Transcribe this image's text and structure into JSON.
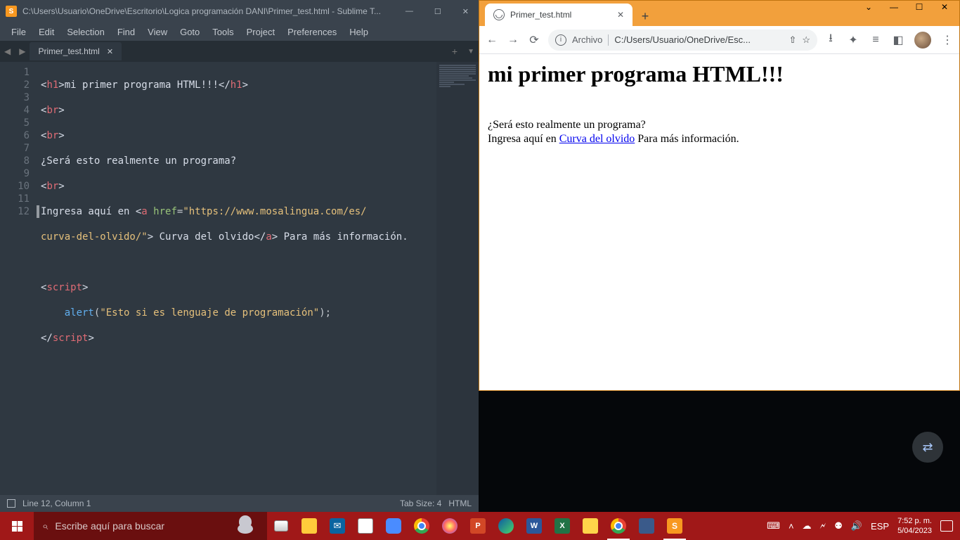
{
  "sublime": {
    "title": "C:\\Users\\Usuario\\OneDrive\\Escritorio\\Logica programación DANI\\Primer_test.html - Sublime T...",
    "menu": [
      "File",
      "Edit",
      "Selection",
      "Find",
      "View",
      "Goto",
      "Tools",
      "Project",
      "Preferences",
      "Help"
    ],
    "tab_label": "Primer_test.html",
    "lines": [
      "1",
      "2",
      "3",
      "4",
      "5",
      "6",
      "7",
      "8",
      "9",
      "10",
      "11",
      "12"
    ],
    "code": {
      "l1_open": "<h1>",
      "l1_txt": "mi primer programa HTML!!!",
      "l1_close": "</h1>",
      "l2": "<br>",
      "l3": "<br>",
      "l4": "¿Será esto realmente un programa?",
      "l5": "<br>",
      "l6a": "Ingresa aquí en ",
      "l6_tag": "<a ",
      "l6_attr": "href",
      "l6_eq": "=",
      "l6_url": "\"https://www.mosalingua.com/es/",
      "l6b_url": "curva-del-olvido/\"",
      "l6b_close": ">",
      "l6b_txt": " Curva del olvido",
      "l6b_cl": "</a>",
      "l6b_tail": " Para más información.",
      "l8_open": "<script>",
      "l9_indent": "    ",
      "l9_fn": "alert",
      "l9_p1": "(",
      "l9_str": "\"Esto si es lenguaje de programación\"",
      "l9_p2": ");",
      "l10_close": "</script>"
    },
    "status": {
      "pos": "Line 12, Column 1",
      "tabsize": "Tab Size: 4",
      "lang": "HTML"
    }
  },
  "chrome": {
    "tab_title": "Primer_test.html",
    "omnibox": {
      "scheme": "Archivo",
      "path": "C:/Users/Usuario/OneDrive/Esc..."
    },
    "page": {
      "h1": "mi primer programa HTML!!!",
      "q": "¿Será esto realmente un programa?",
      "pre": "Ingresa aquí en ",
      "link": "Curva del olvido",
      "post": " Para más información."
    }
  },
  "taskbar": {
    "search_placeholder": "Escribe aquí para buscar",
    "lang": "ESP",
    "time": "7:52 p. m.",
    "date": "5/04/2023"
  }
}
